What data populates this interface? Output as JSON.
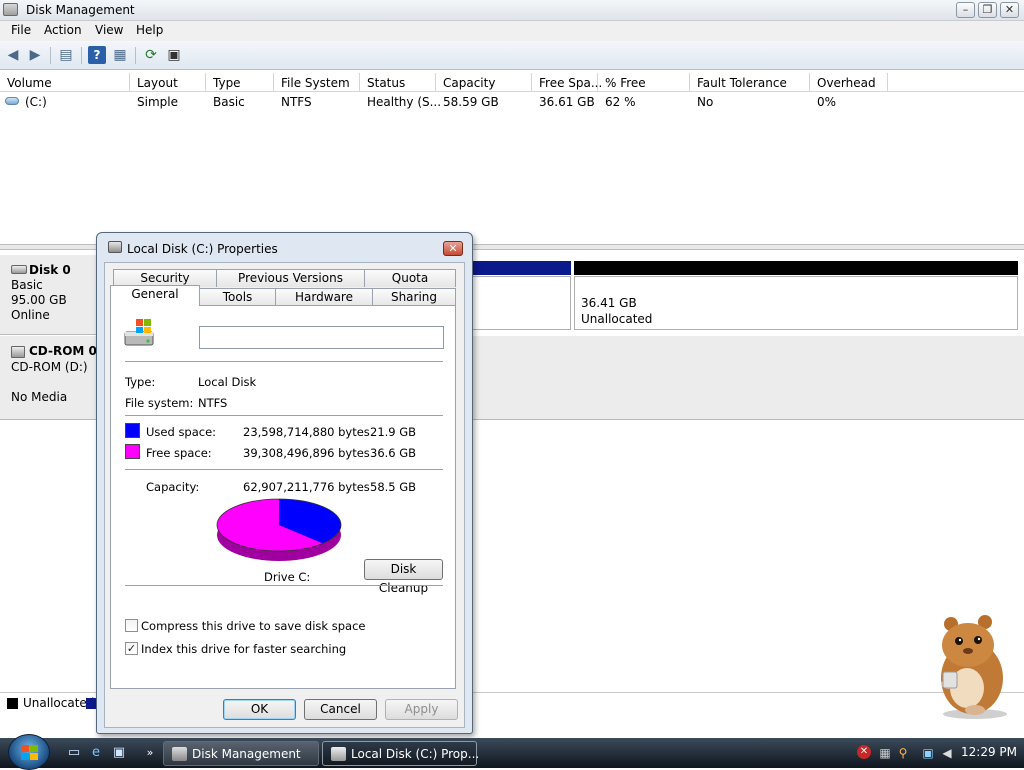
{
  "window": {
    "title": "Disk Management"
  },
  "menu": [
    "File",
    "Action",
    "View",
    "Help"
  ],
  "volume_table": {
    "columns": [
      "Volume",
      "Layout",
      "Type",
      "File System",
      "Status",
      "Capacity",
      "Free Spa...",
      "% Free",
      "Fault Tolerance",
      "Overhead"
    ],
    "rows": [
      [
        "(C:)",
        "Simple",
        "Basic",
        "NTFS",
        "Healthy (S...",
        "58.59 GB",
        "36.61 GB",
        "62 %",
        "No",
        "0%"
      ]
    ]
  },
  "disks": [
    {
      "name": "Disk 0",
      "type": "Basic",
      "size": "95.00 GB",
      "status": "Online"
    },
    {
      "name": "CD-ROM 0",
      "type": "CD-ROM (D:)",
      "status": "No Media"
    }
  ],
  "partition": {
    "size": "36.41 GB",
    "label": "Unallocated"
  },
  "legend": [
    "Unallocated"
  ],
  "dialog": {
    "title": "Local Disk (C:) Properties",
    "tabs_back": [
      "Security",
      "Previous Versions",
      "Quota"
    ],
    "tabs_front": [
      "General",
      "Tools",
      "Hardware",
      "Sharing"
    ],
    "name_value": "",
    "type_label": "Type:",
    "type_value": "Local Disk",
    "fs_label": "File system:",
    "fs_value": "NTFS",
    "used_label": "Used space:",
    "used_bytes": "23,598,714,880 bytes",
    "used_gb": "21.9 GB",
    "free_label": "Free space:",
    "free_bytes": "39,308,496,896 bytes",
    "free_gb": "36.6 GB",
    "cap_label": "Capacity:",
    "cap_bytes": "62,907,211,776 bytes",
    "cap_gb": "58.5 GB",
    "drive_label": "Drive C:",
    "cleanup": "Disk Cleanup",
    "compress": "Compress this drive to save disk space",
    "compress_checked": false,
    "index": "Index this drive for faster searching",
    "index_checked": true,
    "ok": "OK",
    "cancel": "Cancel",
    "apply": "Apply",
    "used_color": "#0000ff",
    "free_color": "#ff00ff",
    "used_fraction": 0.375
  },
  "taskbar": {
    "tasks": [
      "Disk Management",
      "Local Disk (C:) Prop..."
    ],
    "clock": "12:29 PM"
  }
}
